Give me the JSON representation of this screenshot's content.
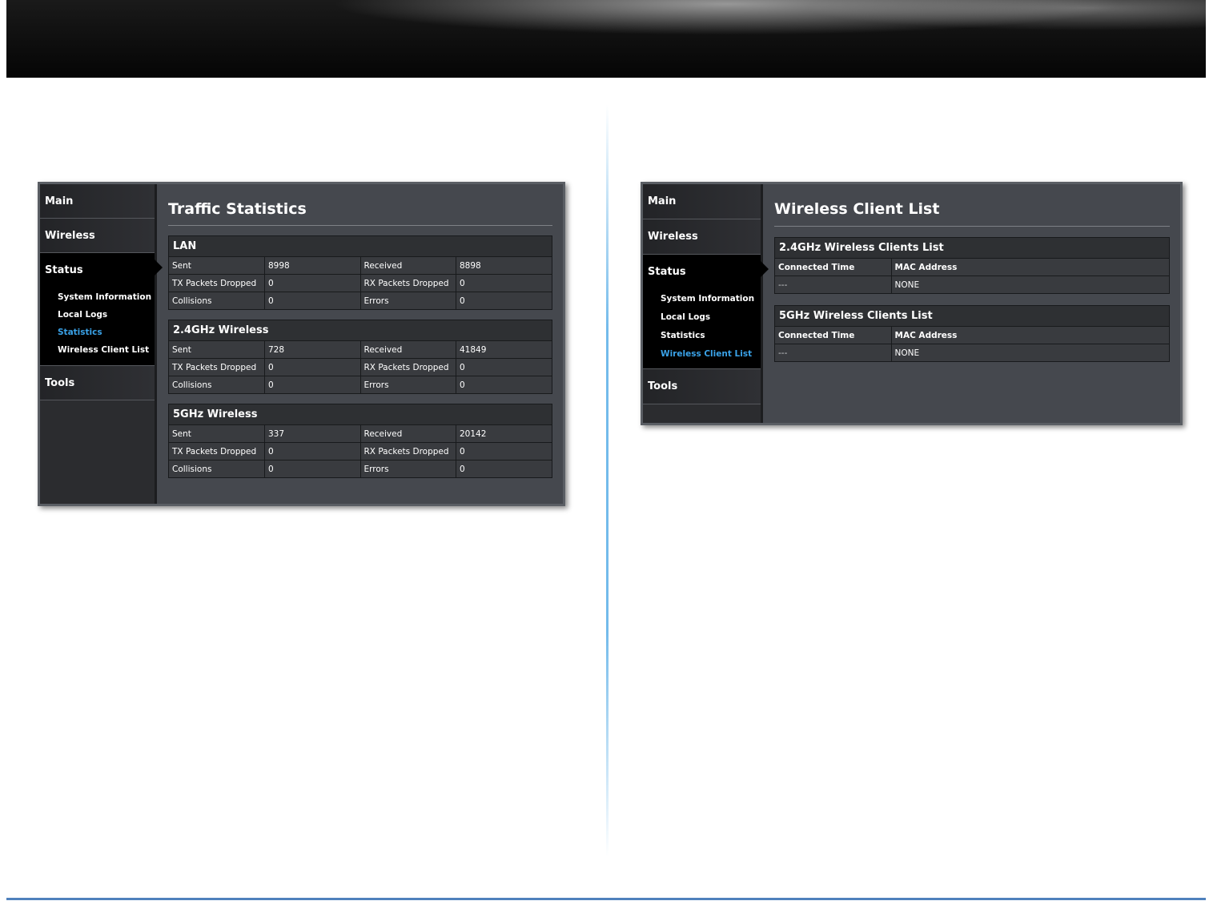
{
  "traffic": {
    "nav": {
      "main": "Main",
      "wireless": "Wireless",
      "status": "Status",
      "sub_items": [
        "System Information",
        "Local Logs",
        "Statistics",
        "Wireless Client List"
      ],
      "active_sub": "Statistics",
      "tools": "Tools"
    },
    "title": "Traffic Statistics",
    "sections": [
      {
        "name": "LAN",
        "rows": [
          {
            "label1": "Sent",
            "value1": "8998",
            "label2": "Received",
            "value2": "8898"
          },
          {
            "label1": "TX Packets Dropped",
            "value1": "0",
            "label2": "RX Packets Dropped",
            "value2": "0"
          },
          {
            "label1": "Collisions",
            "value1": "0",
            "label2": "Errors",
            "value2": "0"
          }
        ]
      },
      {
        "name": "2.4GHz Wireless",
        "rows": [
          {
            "label1": "Sent",
            "value1": "728",
            "label2": "Received",
            "value2": "41849"
          },
          {
            "label1": "TX Packets Dropped",
            "value1": "0",
            "label2": "RX Packets Dropped",
            "value2": "0"
          },
          {
            "label1": "Collisions",
            "value1": "0",
            "label2": "Errors",
            "value2": "0"
          }
        ]
      },
      {
        "name": "5GHz Wireless",
        "rows": [
          {
            "label1": "Sent",
            "value1": "337",
            "label2": "Received",
            "value2": "20142"
          },
          {
            "label1": "TX Packets Dropped",
            "value1": "0",
            "label2": "RX Packets Dropped",
            "value2": "0"
          },
          {
            "label1": "Collisions",
            "value1": "0",
            "label2": "Errors",
            "value2": "0"
          }
        ]
      }
    ]
  },
  "clients": {
    "nav": {
      "main": "Main",
      "wireless": "Wireless",
      "status": "Status",
      "sub_items": [
        "System Information",
        "Local Logs",
        "Statistics",
        "Wireless Client List"
      ],
      "active_sub": "Wireless Client List",
      "tools": "Tools"
    },
    "title": "Wireless Client List",
    "lists": [
      {
        "name": "2.4GHz Wireless Clients List",
        "columns": [
          "Connected Time",
          "MAC Address"
        ],
        "rows": [
          {
            "time": "---",
            "mac": "NONE"
          }
        ]
      },
      {
        "name": "5GHz Wireless Clients List",
        "columns": [
          "Connected Time",
          "MAC Address"
        ],
        "rows": [
          {
            "time": "---",
            "mac": "NONE"
          }
        ]
      }
    ]
  },
  "colors": {
    "active_link": "#3aa2e8",
    "panel_background": "#45484e",
    "table_cell": "#393b3f",
    "rule": "#4f81bd"
  }
}
